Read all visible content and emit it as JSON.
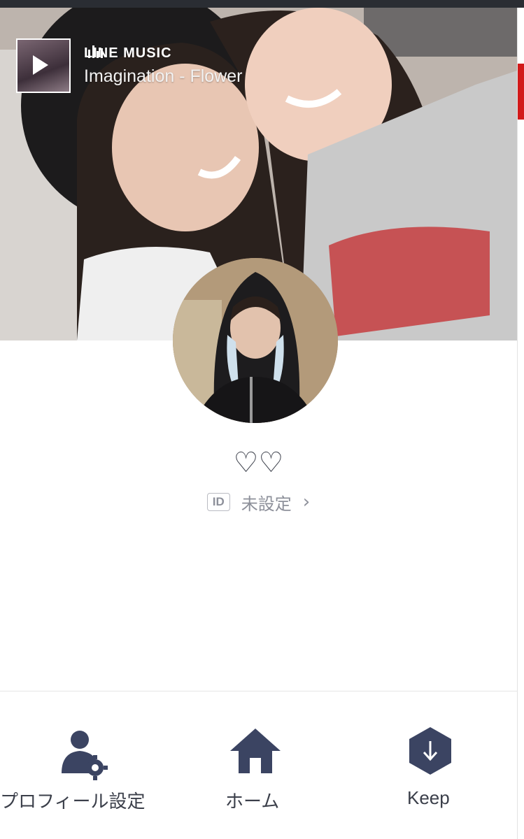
{
  "music": {
    "service": "LINE MUSIC",
    "song": "Imagination - Flower"
  },
  "profile": {
    "name": "♡♡",
    "id_badge": "ID",
    "id_value": "未設定"
  },
  "nav": {
    "profile_settings": "プロフィール設定",
    "home": "ホーム",
    "keep": "Keep"
  },
  "colors": {
    "icon": "#3b4462",
    "text": "#3b3f4a",
    "muted": "#8d909a"
  }
}
